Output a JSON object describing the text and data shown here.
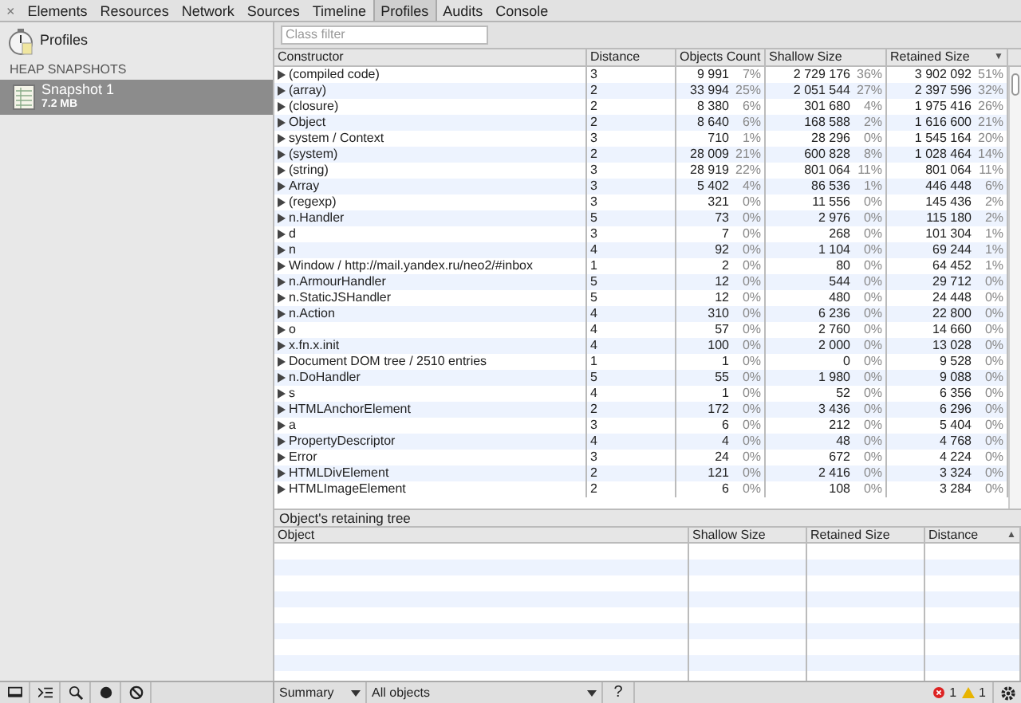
{
  "toolbar": {
    "close": "×",
    "tabs": [
      {
        "label": "Elements",
        "selected": false
      },
      {
        "label": "Resources",
        "selected": false
      },
      {
        "label": "Network",
        "selected": false
      },
      {
        "label": "Sources",
        "selected": false
      },
      {
        "label": "Timeline",
        "selected": false
      },
      {
        "label": "Profiles",
        "selected": true
      },
      {
        "label": "Audits",
        "selected": false
      },
      {
        "label": "Console",
        "selected": false
      }
    ]
  },
  "sidebar": {
    "title": "Profiles",
    "section": "HEAP SNAPSHOTS",
    "items": [
      {
        "name": "Snapshot 1",
        "size": "7.2 MB",
        "selected": true
      }
    ]
  },
  "filter": {
    "placeholder": "Class filter"
  },
  "table": {
    "columns": [
      {
        "label": "Constructor"
      },
      {
        "label": "Distance"
      },
      {
        "label": "Objects Count"
      },
      {
        "label": "Shallow Size"
      },
      {
        "label": "Retained Size",
        "sort": "▼"
      }
    ],
    "rows": [
      {
        "name": "(compiled code)",
        "distance": "3",
        "count": "9 991",
        "count_pct": "7%",
        "shallow": "2 729 176",
        "shallow_pct": "36%",
        "retained": "3 902 092",
        "retained_pct": "51%"
      },
      {
        "name": "(array)",
        "distance": "2",
        "count": "33 994",
        "count_pct": "25%",
        "shallow": "2 051 544",
        "shallow_pct": "27%",
        "retained": "2 397 596",
        "retained_pct": "32%"
      },
      {
        "name": "(closure)",
        "distance": "2",
        "count": "8 380",
        "count_pct": "6%",
        "shallow": "301 680",
        "shallow_pct": "4%",
        "retained": "1 975 416",
        "retained_pct": "26%"
      },
      {
        "name": "Object",
        "distance": "2",
        "count": "8 640",
        "count_pct": "6%",
        "shallow": "168 588",
        "shallow_pct": "2%",
        "retained": "1 616 600",
        "retained_pct": "21%"
      },
      {
        "name": "system / Context",
        "distance": "3",
        "count": "710",
        "count_pct": "1%",
        "shallow": "28 296",
        "shallow_pct": "0%",
        "retained": "1 545 164",
        "retained_pct": "20%"
      },
      {
        "name": "(system)",
        "distance": "2",
        "count": "28 009",
        "count_pct": "21%",
        "shallow": "600 828",
        "shallow_pct": "8%",
        "retained": "1 028 464",
        "retained_pct": "14%"
      },
      {
        "name": "(string)",
        "distance": "3",
        "count": "28 919",
        "count_pct": "22%",
        "shallow": "801 064",
        "shallow_pct": "11%",
        "retained": "801 064",
        "retained_pct": "11%"
      },
      {
        "name": "Array",
        "distance": "3",
        "count": "5 402",
        "count_pct": "4%",
        "shallow": "86 536",
        "shallow_pct": "1%",
        "retained": "446 448",
        "retained_pct": "6%"
      },
      {
        "name": "(regexp)",
        "distance": "3",
        "count": "321",
        "count_pct": "0%",
        "shallow": "11 556",
        "shallow_pct": "0%",
        "retained": "145 436",
        "retained_pct": "2%"
      },
      {
        "name": "n.Handler",
        "distance": "5",
        "count": "73",
        "count_pct": "0%",
        "shallow": "2 976",
        "shallow_pct": "0%",
        "retained": "115 180",
        "retained_pct": "2%"
      },
      {
        "name": "d",
        "distance": "3",
        "count": "7",
        "count_pct": "0%",
        "shallow": "268",
        "shallow_pct": "0%",
        "retained": "101 304",
        "retained_pct": "1%"
      },
      {
        "name": "n",
        "distance": "4",
        "count": "92",
        "count_pct": "0%",
        "shallow": "1 104",
        "shallow_pct": "0%",
        "retained": "69 244",
        "retained_pct": "1%"
      },
      {
        "name": "Window / http://mail.yandex.ru/neo2/#inbox",
        "distance": "1",
        "count": "2",
        "count_pct": "0%",
        "shallow": "80",
        "shallow_pct": "0%",
        "retained": "64 452",
        "retained_pct": "1%"
      },
      {
        "name": "n.ArmourHandler",
        "distance": "5",
        "count": "12",
        "count_pct": "0%",
        "shallow": "544",
        "shallow_pct": "0%",
        "retained": "29 712",
        "retained_pct": "0%"
      },
      {
        "name": "n.StaticJSHandler",
        "distance": "5",
        "count": "12",
        "count_pct": "0%",
        "shallow": "480",
        "shallow_pct": "0%",
        "retained": "24 448",
        "retained_pct": "0%"
      },
      {
        "name": "n.Action",
        "distance": "4",
        "count": "310",
        "count_pct": "0%",
        "shallow": "6 236",
        "shallow_pct": "0%",
        "retained": "22 800",
        "retained_pct": "0%"
      },
      {
        "name": "o",
        "distance": "4",
        "count": "57",
        "count_pct": "0%",
        "shallow": "2 760",
        "shallow_pct": "0%",
        "retained": "14 660",
        "retained_pct": "0%"
      },
      {
        "name": "x.fn.x.init",
        "distance": "4",
        "count": "100",
        "count_pct": "0%",
        "shallow": "2 000",
        "shallow_pct": "0%",
        "retained": "13 028",
        "retained_pct": "0%"
      },
      {
        "name": "Document DOM tree / 2510 entries",
        "distance": "1",
        "count": "1",
        "count_pct": "0%",
        "shallow": "0",
        "shallow_pct": "0%",
        "retained": "9 528",
        "retained_pct": "0%"
      },
      {
        "name": "n.DoHandler",
        "distance": "5",
        "count": "55",
        "count_pct": "0%",
        "shallow": "1 980",
        "shallow_pct": "0%",
        "retained": "9 088",
        "retained_pct": "0%"
      },
      {
        "name": "s",
        "distance": "4",
        "count": "1",
        "count_pct": "0%",
        "shallow": "52",
        "shallow_pct": "0%",
        "retained": "6 356",
        "retained_pct": "0%"
      },
      {
        "name": "HTMLAnchorElement",
        "distance": "2",
        "count": "172",
        "count_pct": "0%",
        "shallow": "3 436",
        "shallow_pct": "0%",
        "retained": "6 296",
        "retained_pct": "0%"
      },
      {
        "name": "a",
        "distance": "3",
        "count": "6",
        "count_pct": "0%",
        "shallow": "212",
        "shallow_pct": "0%",
        "retained": "5 404",
        "retained_pct": "0%"
      },
      {
        "name": "PropertyDescriptor",
        "distance": "4",
        "count": "4",
        "count_pct": "0%",
        "shallow": "48",
        "shallow_pct": "0%",
        "retained": "4 768",
        "retained_pct": "0%"
      },
      {
        "name": "Error",
        "distance": "3",
        "count": "24",
        "count_pct": "0%",
        "shallow": "672",
        "shallow_pct": "0%",
        "retained": "4 224",
        "retained_pct": "0%"
      },
      {
        "name": "HTMLDivElement",
        "distance": "2",
        "count": "121",
        "count_pct": "0%",
        "shallow": "2 416",
        "shallow_pct": "0%",
        "retained": "3 324",
        "retained_pct": "0%"
      },
      {
        "name": "HTMLImageElement",
        "distance": "2",
        "count": "6",
        "count_pct": "0%",
        "shallow": "108",
        "shallow_pct": "0%",
        "retained": "3 284",
        "retained_pct": "0%"
      }
    ]
  },
  "retaining_tree": {
    "title": "Object's retaining tree",
    "columns": [
      {
        "label": "Object"
      },
      {
        "label": "Shallow Size"
      },
      {
        "label": "Retained Size"
      },
      {
        "label": "Distance",
        "sort": "▲"
      }
    ]
  },
  "status_bar": {
    "view": "Summary",
    "filter": "All objects",
    "help": "?",
    "errors": "1",
    "warnings": "1"
  }
}
